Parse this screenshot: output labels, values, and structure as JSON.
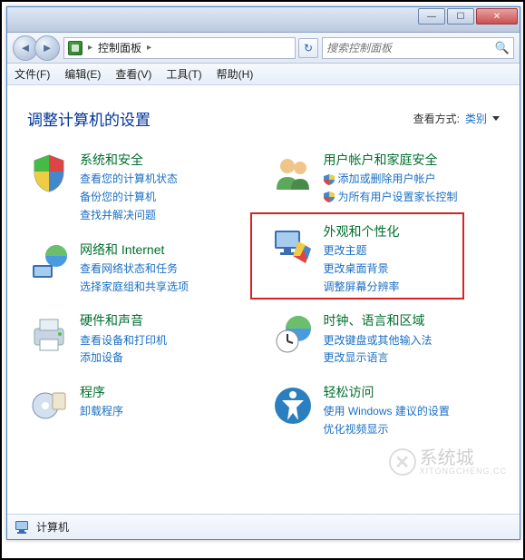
{
  "titlebar": {
    "minimize": "—",
    "maximize": "☐",
    "close": "✕"
  },
  "toolbar": {
    "back": "◄",
    "forward": "►",
    "refresh": "↻",
    "crumb_root": "控制面板",
    "crumb_sep": "▸",
    "search_placeholder": "搜索控制面板"
  },
  "menubar": {
    "file": "文件(F)",
    "edit": "编辑(E)",
    "view": "查看(V)",
    "tools": "工具(T)",
    "help": "帮助(H)"
  },
  "content": {
    "heading": "调整计算机的设置",
    "view_by_label": "查看方式:",
    "view_by_value": "类别"
  },
  "categories": {
    "system": {
      "title": "系统和安全",
      "links": [
        "查看您的计算机状态",
        "备份您的计算机",
        "查找并解决问题"
      ]
    },
    "user": {
      "title": "用户帐户和家庭安全",
      "links": [
        "添加或删除用户帐户",
        "为所有用户设置家长控制"
      ]
    },
    "network": {
      "title": "网络和 Internet",
      "links": [
        "查看网络状态和任务",
        "选择家庭组和共享选项"
      ]
    },
    "appearance": {
      "title": "外观和个性化",
      "links": [
        "更改主题",
        "更改桌面背景",
        "调整屏幕分辨率"
      ]
    },
    "hardware": {
      "title": "硬件和声音",
      "links": [
        "查看设备和打印机",
        "添加设备"
      ]
    },
    "clock": {
      "title": "时钟、语言和区域",
      "links": [
        "更改键盘或其他输入法",
        "更改显示语言"
      ]
    },
    "programs": {
      "title": "程序",
      "links": [
        "卸载程序"
      ]
    },
    "ease": {
      "title": "轻松访问",
      "links": [
        "使用 Windows 建议的设置",
        "优化视频显示"
      ]
    }
  },
  "statusbar": {
    "label": "计算机"
  },
  "watermark": {
    "text": "系统城",
    "sub": "XITONGCHENG.CC"
  }
}
